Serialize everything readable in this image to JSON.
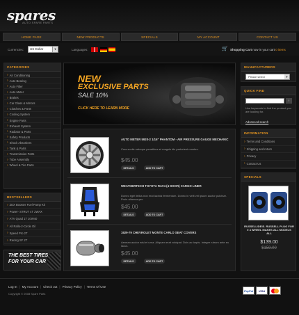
{
  "header": {
    "logo": "spares",
    "tagline": "AUTO SPARE PARTS"
  },
  "nav": [
    "HOME PAGE",
    "NEW PRODUCTS",
    "SPECIALS",
    "MY ACCOUNT",
    "CONTACT US"
  ],
  "toolbar": {
    "currency_label": "Currencies:",
    "currency_value": "US Dollar",
    "languages_label": "Languages:",
    "cart_label": "Shopping Cart",
    "cart_suffix": "now in your cart",
    "cart_count": "0 items"
  },
  "categories": {
    "title": "CATEGORIES",
    "items": [
      "Air Conditioning",
      "Auto Bearing",
      "Auto Filter",
      "Auto Meter",
      "Brakes",
      "Car Glass & Mirrors",
      "Clutches & Parts",
      "Cooling System",
      "Engine Parts",
      "Exhaust System",
      "Radiator & Parts",
      "Safety Products",
      "Shock Absorbers",
      "Tank & Parts",
      "Transmission Parts",
      "Tube Assembly",
      "Wheel & Tire Parts"
    ]
  },
  "bestsellers": {
    "title": "BESTSELLERS",
    "items": [
      "ZEX Booster Fuel Pump Kit",
      "Power- STRUT 4T 2WAX",
      "ATV Quad 1T 10W40",
      "All Rallo-2-Circle Oil",
      "Speed Pro 2T",
      "Racing SF 2T"
    ]
  },
  "tires_banner": {
    "line1": "THE BEST TIRES",
    "line2": "FOR YOUR CAR"
  },
  "banner": {
    "line1": "NEW",
    "line2": "EXCLUSIVE PARTS",
    "line3": "SALE 10%",
    "cta": "CLICK HERE TO LEARN MORE"
  },
  "products": [
    {
      "title": "AUTO METER 5920-2 1/16\" PHANTOM - AIR PRESSURE GAUGE MECHANIC",
      "desc": "Cras sociis natoque penatibus et magnis dis parturient montes.",
      "price": "$45.00",
      "details": "DETAILS",
      "add": "ADD TO CART"
    },
    {
      "title": "WEATHERTECH TOYOTA RAV4 (4 DOOR) CARGO LINER",
      "desc": "Donec eget tellus non erat lacinia fermentum. Donec in velit vel ipsum auctor pulvinar. Proin ullamcorper.",
      "price": "$45.00",
      "details": "DETAILS",
      "add": "ADD TO CART"
    },
    {
      "title": "1929-79 CHEVROLET MONTE CARLO SEAT COVERS",
      "desc": "Aenean auctor wisi et urna. Aliquam erat volutpat. Duis ac turpis. Integer rutrum ante eu lacus.",
      "price": "$45.00",
      "details": "DETAILS",
      "add": "ADD TO CART"
    }
  ],
  "manufacturers": {
    "title": "MANUFACTURERS",
    "select": "Please select"
  },
  "quickfind": {
    "title": "QUICK FIND",
    "text": "Use keywords to find the product you are looking for.",
    "advanced": "Advanced search",
    "go": "›"
  },
  "information": {
    "title": "INFORMATION",
    "items": [
      "Terms and Conditions",
      "Shipping and return",
      "Privacy",
      "Contact Us"
    ]
  },
  "specials": {
    "title": "SPECIALS",
    "name": "RUSSELL/DEIS. RUSSELL PLUG FOR 0 4 WHEEL MAKES ALL MODELS ALL",
    "price": "$139.00",
    "old_price": "$159.00"
  },
  "footer": {
    "links": [
      "Log In",
      "My Account",
      "Check out",
      "Privacy Policy",
      "Terms Of Use"
    ],
    "copyright": "Copyright © 2008 Spare Parts"
  },
  "payment": [
    "PayPal",
    "VISA",
    "MasterCard"
  ]
}
